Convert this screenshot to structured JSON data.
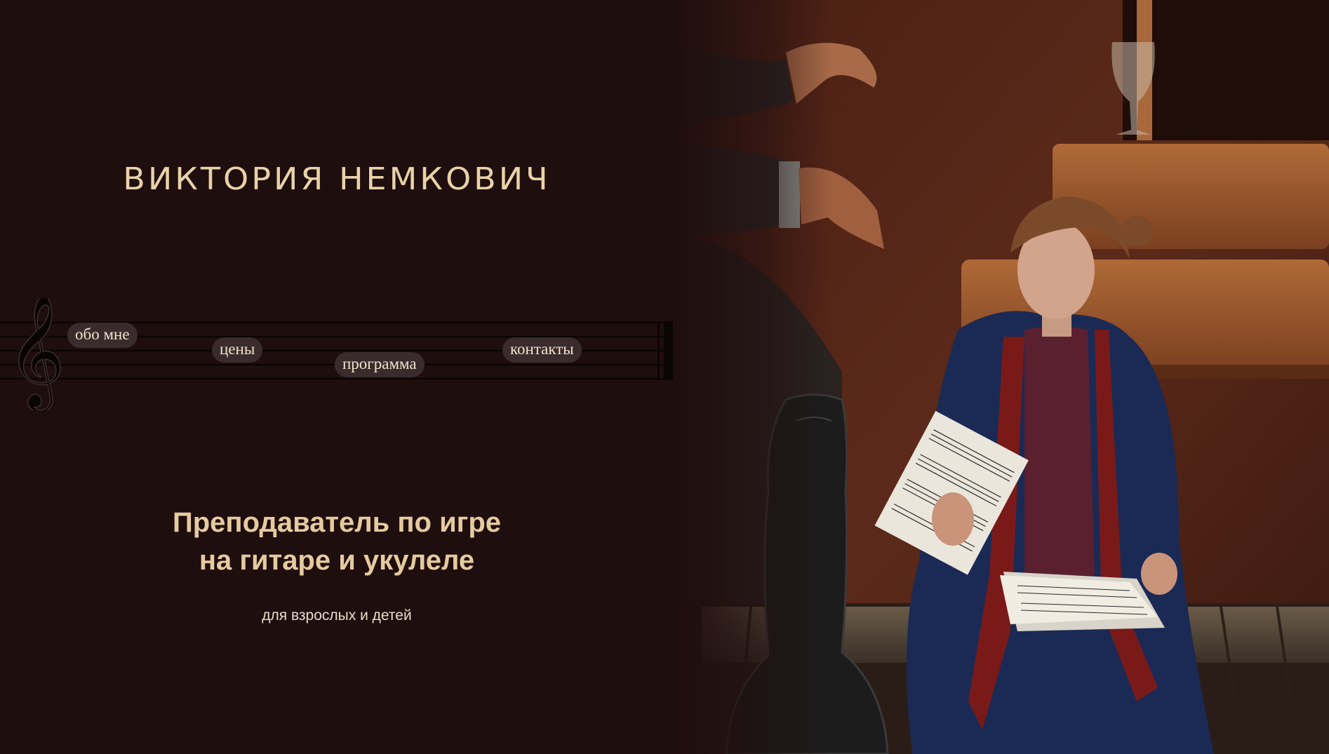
{
  "header": {
    "name": "ВИКТОРИЯ НЕМКОВИЧ"
  },
  "nav": {
    "items": [
      {
        "label": "обо мне"
      },
      {
        "label": "цены"
      },
      {
        "label": "программа"
      },
      {
        "label": "контакты"
      }
    ]
  },
  "hero": {
    "headline_line1": "Преподаватель по игре",
    "headline_line2": "на гитаре и укулеле",
    "subline": "для взрослых и детей"
  },
  "icons": {
    "staff": "treble-clef-icon"
  },
  "colors": {
    "background": "#1f0e0e",
    "title": "#ead2a8",
    "headline": "#e6caa0",
    "nav_pill": "#3a2c2c",
    "nav_text": "#efe2cf"
  }
}
